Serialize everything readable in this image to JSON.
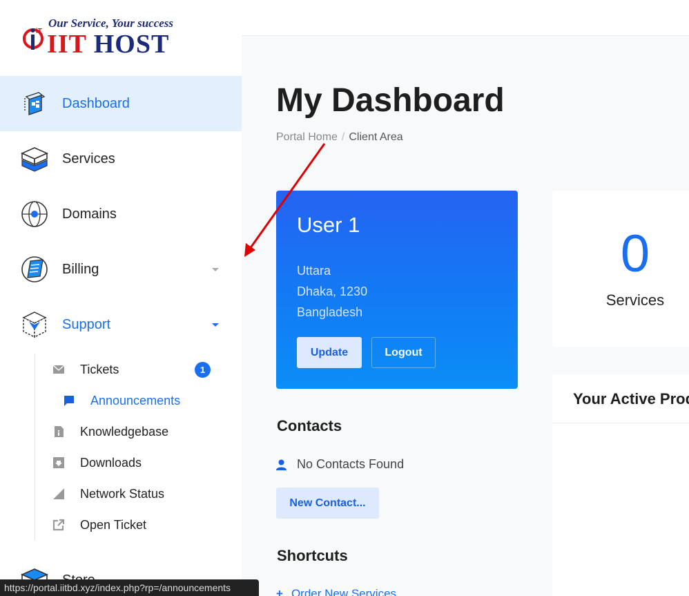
{
  "brand": {
    "tagline": "Our Service, Your success",
    "name_red": "IIT",
    "name_blue": "HOST",
    "mark_text": "iT"
  },
  "sidebar": {
    "items": [
      {
        "label": "Dashboard",
        "icon": "dashboard-icon"
      },
      {
        "label": "Services",
        "icon": "services-icon"
      },
      {
        "label": "Domains",
        "icon": "domains-icon"
      },
      {
        "label": "Billing",
        "icon": "billing-icon"
      },
      {
        "label": "Support",
        "icon": "support-icon"
      },
      {
        "label": "Store",
        "icon": "store-icon"
      }
    ],
    "support_children": [
      {
        "label": "Tickets",
        "icon": "envelope-icon",
        "badge": "1"
      },
      {
        "label": "Announcements",
        "icon": "comment-icon"
      },
      {
        "label": "Knowledgebase",
        "icon": "document-icon"
      },
      {
        "label": "Downloads",
        "icon": "download-icon"
      },
      {
        "label": "Network Status",
        "icon": "signal-icon"
      },
      {
        "label": "Open Ticket",
        "icon": "external-link-icon"
      }
    ]
  },
  "status_url": "https://portal.iitbd.xyz/index.php?rp=/announcements",
  "header": {
    "title": "My Dashboard",
    "breadcrumb": [
      "Portal Home",
      "Client Area"
    ],
    "breadcrumb_sep": "/"
  },
  "user_card": {
    "name": "User 1",
    "address_lines": [
      "Uttara",
      "Dhaka, 1230",
      "Bangladesh"
    ],
    "update_label": "Update",
    "logout_label": "Logout"
  },
  "stats": {
    "services_count": "0",
    "services_label": "Services"
  },
  "products": {
    "title": "Your Active Prod"
  },
  "contacts": {
    "title": "Contacts",
    "empty_text": "No Contacts Found",
    "new_label": "New Contact..."
  },
  "shortcuts": {
    "title": "Shortcuts",
    "items": [
      {
        "label": "Order New Services"
      }
    ]
  },
  "colors": {
    "accent": "#1a6ff0",
    "active_bg": "#e2effd",
    "annotation_arrow": "#e00000"
  }
}
